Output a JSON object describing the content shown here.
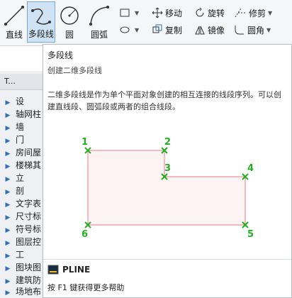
{
  "ribbon": {
    "tools": [
      {
        "label": "直线",
        "icon": "line-icon"
      },
      {
        "label": "多段线",
        "icon": "polyline-icon",
        "active": true
      },
      {
        "label": "圆",
        "icon": "circle-icon"
      },
      {
        "label": "圆弧",
        "icon": "arc-icon"
      }
    ],
    "modify": [
      {
        "label": "移动",
        "icon": "move-icon"
      },
      {
        "label": "旋转",
        "icon": "rotate-icon"
      },
      {
        "label": "修剪",
        "icon": "trim-icon"
      },
      {
        "label": "复制",
        "icon": "copy-icon"
      },
      {
        "label": "镜像",
        "icon": "mirror-icon"
      },
      {
        "label": "圆角",
        "icon": "fillet-icon"
      }
    ]
  },
  "sidebar": {
    "header": "T...",
    "items": [
      "设",
      "轴网柱",
      "墙",
      "门",
      "房间屋",
      "楼梯其",
      "立",
      "剖",
      "文字表",
      "尺寸标",
      "符号标",
      "图层控",
      "工",
      "图块图",
      "建筑防",
      "场地布"
    ]
  },
  "tooltip": {
    "title": "多段线",
    "subtitle": "创建二维多段线",
    "description": "二维多段线是作为单个平面对象创建的相互连接的线段序列。可以创建直线段、圆弧段或两者的组合线段。",
    "points": [
      "1",
      "2",
      "3",
      "4",
      "5",
      "6"
    ],
    "command": "PLINE",
    "help": "按 F1 键获得更多帮助"
  },
  "colors": {
    "accent": "#2d6fb8",
    "point_marker": "#22b022",
    "polyline": "#e87a8a"
  }
}
